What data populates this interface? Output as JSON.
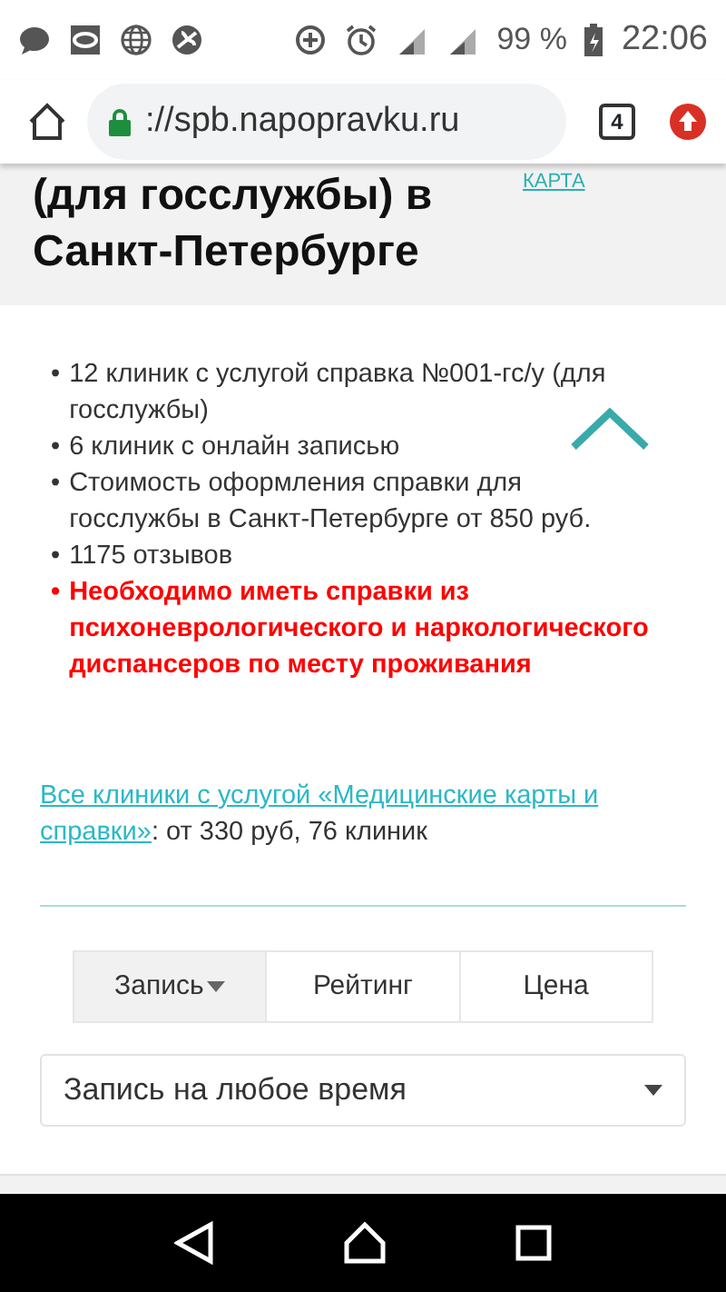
{
  "status_bar": {
    "battery": "99 %",
    "time": "22:06"
  },
  "browser": {
    "url": "://spb.napopravku.ru",
    "tab_count": "4"
  },
  "header": {
    "title": "(для госслужбы) в Санкт-Петербурге",
    "map_link": "КАРТА"
  },
  "facts": [
    {
      "bullet": "•",
      "text": "12 клиник с услугой справка №001-гс/у (для госслужбы)",
      "warning": false
    },
    {
      "bullet": "•",
      "text": "6 клиник с онлайн записью",
      "warning": false
    },
    {
      "bullet": "•",
      "text": "Стоимость оформления справки для госслужбы в Санкт-Петербурге от 850 руб.",
      "warning": false
    },
    {
      "bullet": "•",
      "text": "1175 отзывов",
      "warning": false
    },
    {
      "bullet": "•",
      "text": "Необходимо иметь справки из психоневрологического и наркологического диспансеров по месту проживания",
      "warning": true
    }
  ],
  "related": {
    "link_lines": [
      "Все клиники с услугой «Медицинские карты и",
      "справки»"
    ],
    "rest": ": от 330 руб, 76 клиник"
  },
  "sort_tabs": [
    {
      "label": "Запись",
      "selected": true,
      "dropdown": true
    },
    {
      "label": "Рейтинг",
      "selected": false,
      "dropdown": false
    },
    {
      "label": "Цена",
      "selected": false,
      "dropdown": false
    }
  ],
  "filter": {
    "value": "Запись на любое время"
  }
}
